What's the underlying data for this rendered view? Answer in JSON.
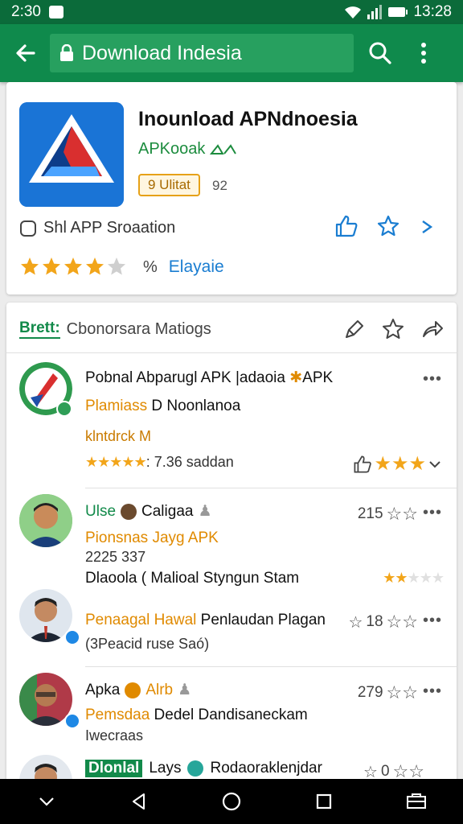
{
  "status": {
    "time_left": "2:30",
    "time_right": "13:28"
  },
  "toolbar": {
    "url_text": "Download Indesia"
  },
  "app": {
    "title": "Inounload APNdnoesia",
    "developer": "APKooak",
    "badge": "9 Ulitat",
    "badge_count": "92",
    "share_label": "Shl APP Sroaation",
    "rating_pct": "%",
    "category": "Elayaie"
  },
  "section": {
    "tag": "Brett:",
    "title": "Cbonorsara Matiogs"
  },
  "items": [
    {
      "title": "Pobnal Abparugl APK |adaoia",
      "title_suffix": "APK",
      "subtitle_orange": "Plamiass",
      "subtitle_rest": " D Noonlanoa",
      "note": "klntdrck M",
      "rating_text": ": 7.36 saddan"
    },
    {
      "name": "Ulse",
      "name2": "Caligaa",
      "count": "215",
      "line2": "Pionsnas Jayg APK",
      "line3": "2225 337",
      "line4": "Dlaoola ( Malioal Styngun Stam"
    },
    {
      "line1_orange": "Penaagal Hawal",
      "line1_rest": " Penlaudan Plagan",
      "count": "18",
      "line2": "(3Peacid ruse Saó)"
    },
    {
      "name": "Apka",
      "name2": "Alrb",
      "count": "279",
      "line2_orange": "Pemsdaa",
      "line2_rest": " Dedel Dandisaneckam",
      "line3": "Iwecraas"
    },
    {
      "tag": "Dlonlal",
      "line1": "Lays",
      "line1_rest": "Rodaoraklenjdar",
      "count": "0"
    }
  ],
  "colors": {
    "primary": "#0f8a4c",
    "status": "#0b6b3a",
    "accent": "#1a7dd1",
    "star": "#f2a51a"
  }
}
